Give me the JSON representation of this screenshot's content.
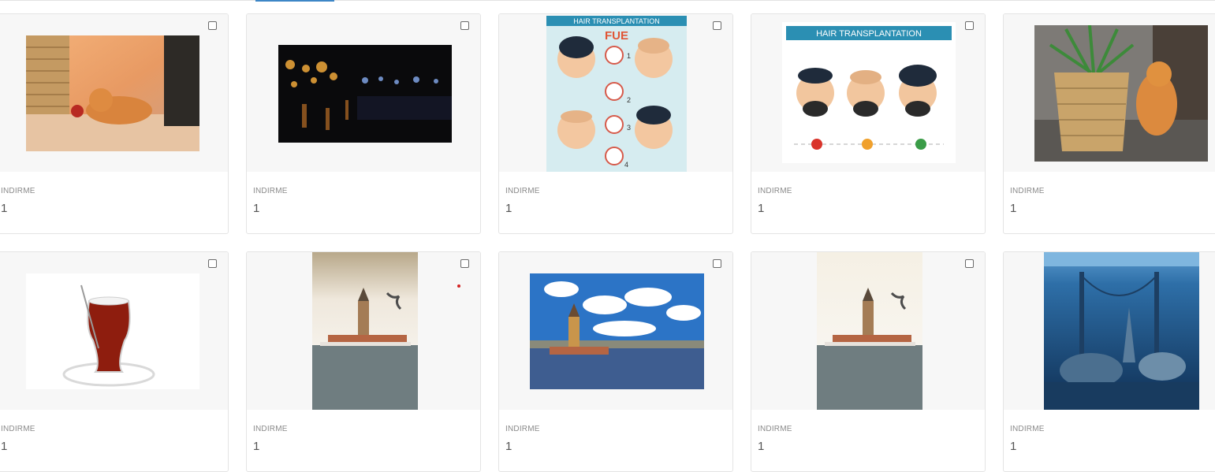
{
  "cards": [
    {
      "image": "cat-with-ornament-photo",
      "label": "INDIRME",
      "value": "1"
    },
    {
      "image": "night-waterfront-bokeh-photo",
      "label": "INDIRME",
      "value": "1"
    },
    {
      "image": "hair-transplantation-fue-infographic",
      "label": "INDIRME",
      "value": "1",
      "banner": "HAIR TRANSPLANTATION",
      "heading": "FUE",
      "steps": [
        "1",
        "2",
        "3",
        "4"
      ]
    },
    {
      "image": "hair-transplantation-steps-infographic",
      "label": "INDIRME",
      "value": "1",
      "banner": "HAIR TRANSPLANTATION"
    },
    {
      "image": "cat-beside-basket-plant-photo",
      "label": "INDIRME",
      "value": "1"
    },
    {
      "image": "turkish-tea-glass-photo",
      "label": "INDIRME",
      "value": "1"
    },
    {
      "image": "maidens-tower-seagull-photo",
      "label": "INDIRME",
      "value": "1"
    },
    {
      "image": "maidens-tower-blue-sky-photo",
      "label": "INDIRME",
      "value": "1"
    },
    {
      "image": "maidens-tower-seagull-photo",
      "label": "INDIRME",
      "value": "1"
    },
    {
      "image": "underwater-istanbul-artwork",
      "label": "INDIRME",
      "value": "1"
    }
  ],
  "colors": {
    "tab_accent": "#3d86c6",
    "banner": "#2b8fb3",
    "indicator_dot": "#d32222"
  }
}
